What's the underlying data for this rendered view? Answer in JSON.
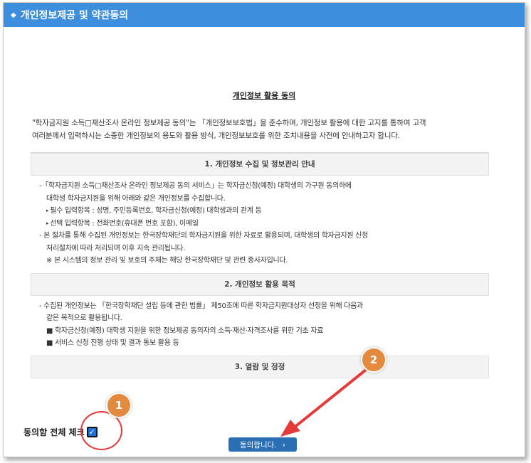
{
  "window": {
    "title": "개인정보제공 및 약관동의",
    "accent_color": "#3d8fdd"
  },
  "document": {
    "heading": "개인정보 활용 동의",
    "intro_lines": [
      "\"학자금지원 소득□재산조사 온라인 정보제공 동의\"는 「개인정보보호법」을 준수하며, 개인정보 활용에 대한 고지를 통하여 고객",
      "여러분께서 입력하시는 소중한 개인정보의 용도와 활용 방식, 개인정보보호를 위한 조치내용을 사전에 안내하고자 합니다."
    ]
  },
  "sections": [
    {
      "title": "1. 개인정보 수집 및 정보관리 안내",
      "lines": [
        "-「학자금지원 소득□재산조사 온라인 정보제공 동의 서비스」는 학자금신청(예정) 대학생의 가구원 동의하에",
        "대학생 학자금지원을 위해 아래와 같은 개인정보를 수집합니다.",
        "필수 입력항목 : 성명, 주민등록번호, 학자금신청(예정) 대학생과의 관계 등",
        "선택 입력항목 : 전화번호(휴대폰 번호 포함), 이메일",
        "- 본 절차를 통해 수집된 개인정보는 한국장학재단의 학자금지원을 위한 자료로 활용되며, 대학생의 학자금지원 신청",
        "처리절차에 따라 처리되며 이후 지속 관리됩니다.",
        "※ 본 시스템의 정보 관리 및 보호의 주체는 해당 한국장학재단 및 관련 종사자입니다."
      ]
    },
    {
      "title": "2. 개인정보 활용 목적",
      "lines": [
        "- 수집된 개인정보는 「한국장학재단 설립 등에 관한 법률」 제50조에 따른 학자금지원대상자 선정을 위해 다음과",
        "같은 목적으로 활용됩니다.",
        "■ 학자금신청(예정) 대학생 지원을 위한 정보제공 동의자의 소득·재산·자격조사를 위한 기초 자료",
        "■ 서비스 신청 진행 상태 및 결과 통보 활용 등"
      ]
    },
    {
      "title": "3. 열람 및 정정"
    }
  ],
  "agree_all": {
    "label": "동의함 전체 체크",
    "checked": true
  },
  "agree_button": {
    "label": "동의합니다.",
    "chevron": "›",
    "color": "#2a6fb4"
  },
  "callouts": [
    {
      "number": "1",
      "color": "#e48a3f"
    },
    {
      "number": "2",
      "color": "#e48a3f"
    }
  ],
  "annotation_color": "#e53a3a"
}
